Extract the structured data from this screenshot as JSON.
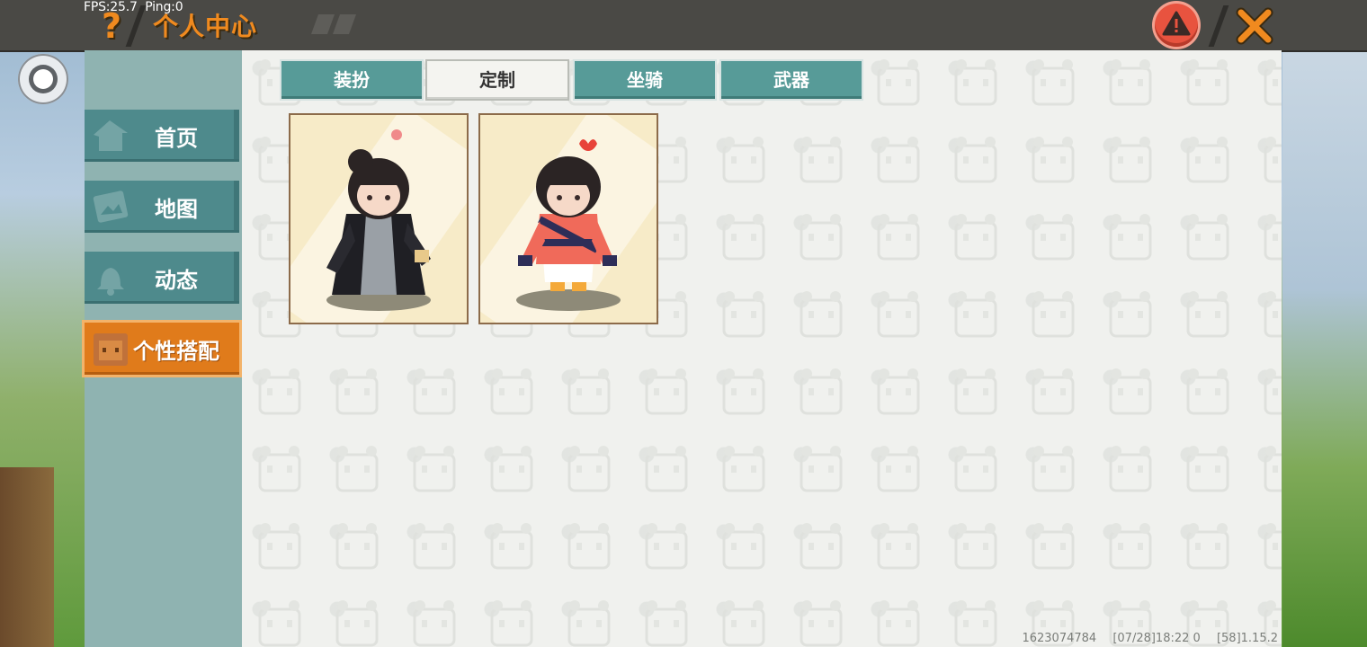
{
  "status": {
    "fps": "FPS:25.7",
    "ping": "Ping:0"
  },
  "header": {
    "title": "个人中心",
    "help_icon": "question-mark-icon",
    "warning_icon": "warning-triangle-icon",
    "close_icon": "close-x-icon"
  },
  "sidebar": {
    "items": [
      {
        "label": "首页",
        "icon": "house-icon",
        "active": false
      },
      {
        "label": "地图",
        "icon": "map-icon",
        "active": false
      },
      {
        "label": "动态",
        "icon": "bell-icon",
        "active": false
      },
      {
        "label": "个性搭配",
        "icon": "character-icon",
        "active": true
      }
    ]
  },
  "tabs": [
    {
      "label": "装扮",
      "selected": false
    },
    {
      "label": "定制",
      "selected": true
    },
    {
      "label": "坐骑",
      "selected": false
    },
    {
      "label": "武器",
      "selected": false
    }
  ],
  "outfits": [
    {
      "name": "black-robe-character"
    },
    {
      "name": "red-uniform-character"
    }
  ],
  "footer": {
    "uid": "1623074784",
    "time": "[07/28]18:22 0",
    "version": "[58]1.15.2"
  },
  "colors": {
    "accent_orange": "#f08a1f",
    "teal": "#579b98",
    "topbar": "#4a4945"
  }
}
